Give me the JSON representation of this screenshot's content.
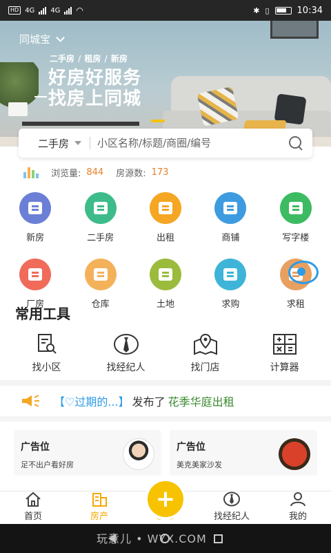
{
  "statusbar": {
    "network": "4G",
    "network2": "4G",
    "time": "10:34"
  },
  "banner": {
    "city": "同城宝",
    "tag1": "二手房",
    "tag2": "租房",
    "tag3": "新房",
    "headline1": "好房好服务",
    "headline2": "找房上同城"
  },
  "search": {
    "type": "二手房",
    "placeholder": "小区名称/标题/商圈/编号"
  },
  "stats": {
    "views_label": "浏览量:",
    "views": "844",
    "listings_label": "房源数:",
    "listings": "173"
  },
  "categories": [
    {
      "label": "新房",
      "color": "#6b7fd6"
    },
    {
      "label": "二手房",
      "color": "#3dbb8a"
    },
    {
      "label": "出租",
      "color": "#f5a623"
    },
    {
      "label": "商铺",
      "color": "#3e9be0"
    },
    {
      "label": "写字楼",
      "color": "#3dbb62"
    },
    {
      "label": "厂房",
      "color": "#f06b5a"
    },
    {
      "label": "仓库",
      "color": "#f3b25a"
    },
    {
      "label": "土地",
      "color": "#9bbb3d"
    },
    {
      "label": "求购",
      "color": "#3eb5d8"
    },
    {
      "label": "求租",
      "color": "#e8a060"
    }
  ],
  "tools": {
    "title": "常用工具",
    "items": [
      {
        "label": "找小区"
      },
      {
        "label": "找经纪人"
      },
      {
        "label": "找门店"
      },
      {
        "label": "计算器"
      }
    ]
  },
  "notice": {
    "user": "【♡过期的...】",
    "action": "发布了",
    "title": "花季华庭出租"
  },
  "ads": [
    {
      "title": "广告位",
      "subtitle": "足不出户看好房"
    },
    {
      "title": "广告位",
      "subtitle": "美克美家沙发"
    }
  ],
  "tabbar": {
    "items": [
      {
        "label": "首页"
      },
      {
        "label": "房产"
      },
      {
        "label": "发布"
      },
      {
        "label": "找经纪人"
      },
      {
        "label": "我的"
      }
    ],
    "active_color": "#f5a800"
  },
  "watermark": "玩意儿 • WYX.COM"
}
